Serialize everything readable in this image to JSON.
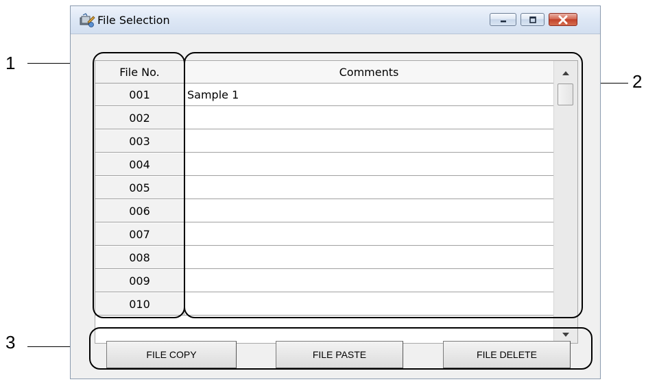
{
  "window": {
    "title": "File Selection"
  },
  "table": {
    "headers": {
      "file_no": "File No.",
      "comments": "Comments"
    },
    "rows": [
      {
        "file_no": "001",
        "comment": "Sample 1"
      },
      {
        "file_no": "002",
        "comment": ""
      },
      {
        "file_no": "003",
        "comment": ""
      },
      {
        "file_no": "004",
        "comment": ""
      },
      {
        "file_no": "005",
        "comment": ""
      },
      {
        "file_no": "006",
        "comment": ""
      },
      {
        "file_no": "007",
        "comment": ""
      },
      {
        "file_no": "008",
        "comment": ""
      },
      {
        "file_no": "009",
        "comment": ""
      },
      {
        "file_no": "010",
        "comment": ""
      }
    ]
  },
  "buttons": {
    "copy": "FILE COPY",
    "paste": "FILE PASTE",
    "delete": "FILE DELETE"
  },
  "callouts": {
    "c1": "1",
    "c2": "2",
    "c3": "3"
  },
  "icons": {
    "app": "file-selection-icon",
    "minimize": "minimize-icon",
    "maximize": "maximize-icon",
    "close": "close-icon",
    "scroll_up": "scroll-up-arrow-icon",
    "scroll_down": "scroll-down-arrow-icon"
  },
  "colors": {
    "close_button": "#c1412a",
    "titlebar": "#dde7f5",
    "highlight": "#000000"
  }
}
